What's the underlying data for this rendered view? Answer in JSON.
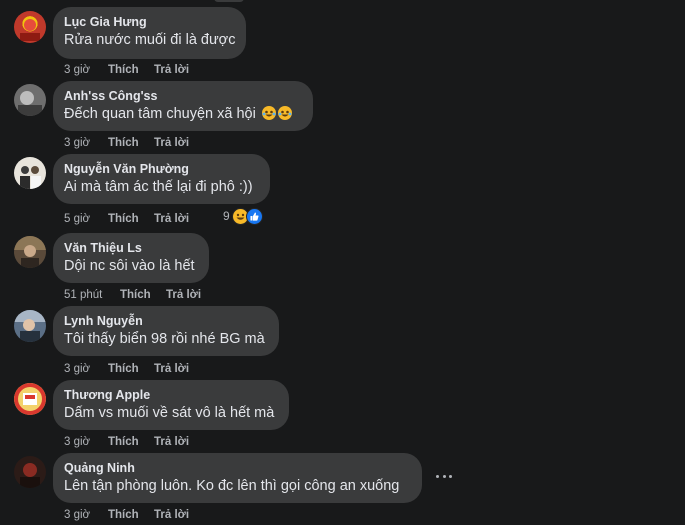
{
  "comments": [
    {
      "author": "Lục Gia Hưng",
      "text": "Rửa nước muối đi là được",
      "time": "3 giờ",
      "like": "Thích",
      "reply": "Trả lời",
      "avatar_colors": [
        "#c0392b",
        "#f1c40f"
      ]
    },
    {
      "author": "Anh'ss Công'ss",
      "text": "Đếch quan tâm chuyện xã hội",
      "emoji_icons": [
        "tears-of-joy-icon",
        "tears-of-joy-icon"
      ],
      "time": "3 giờ",
      "like": "Thích",
      "reply": "Trả lời",
      "avatar_colors": [
        "#7a7a7a",
        "#cfcfcf"
      ]
    },
    {
      "author": "Nguyễn Văn Phường",
      "text": "Ai mà tâm ác thế lại đi phô :))",
      "time": "5 giờ",
      "like": "Thích",
      "reply": "Trả lời",
      "reaction_count": "9",
      "reaction_icons": [
        "grin-reaction-icon",
        "like-reaction-icon"
      ],
      "avatar_colors": [
        "#e8e4dc",
        "#3b3b3b"
      ]
    },
    {
      "author": "Văn Thiệu Ls",
      "text": "Dội nc sôi vào là hết",
      "time": "51 phút",
      "like": "Thích",
      "reply": "Trả lời",
      "avatar_colors": [
        "#5a4a3a",
        "#a08a6a"
      ]
    },
    {
      "author": "Lynh Nguyễn",
      "text": "Tôi thấy biển 98 rồi nhé BG mà",
      "time": "3 giờ",
      "like": "Thích",
      "reply": "Trả lời",
      "avatar_colors": [
        "#5b6f86",
        "#c9d2dc"
      ]
    },
    {
      "author": "Thương Apple",
      "text": "Dấm vs muối về sát vô là hết mà",
      "time": "3 giờ",
      "like": "Thích",
      "reply": "Trả lời",
      "avatar_colors": [
        "#d9382e",
        "#f3d26b"
      ]
    },
    {
      "author": "Quảng Ninh",
      "text": "Lên tận phòng luôn. Ko đc lên thì gọi công an xuống",
      "time": "3 giờ",
      "like": "Thích",
      "reply": "Trả lời",
      "avatar_colors": [
        "#2b1b17",
        "#8a2b22"
      ],
      "more_icon": "more-options-icon"
    }
  ],
  "colors": {
    "background": "#18191a",
    "bubble": "#3a3b3c",
    "primary_text": "#e4e6eb",
    "secondary_text": "#b0b3b8",
    "like_blue": "#1877f2",
    "reaction_yellow": "#f7b928"
  }
}
